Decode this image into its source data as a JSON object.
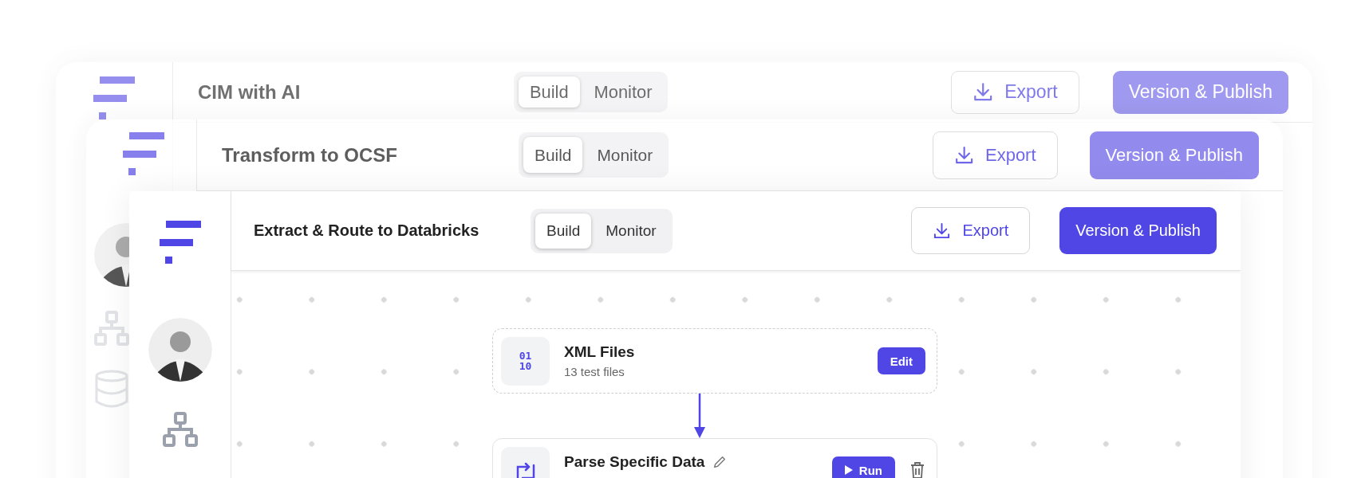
{
  "windows": [
    {
      "title": "CIM with AI",
      "tabs": [
        {
          "label": "Build",
          "selected": true
        },
        {
          "label": "Monitor",
          "selected": false
        }
      ],
      "export_label": "Export",
      "publish_label": "Version & Publish"
    },
    {
      "title": "Transform to OCSF",
      "tabs": [
        {
          "label": "Build",
          "selected": true
        },
        {
          "label": "Monitor",
          "selected": false
        }
      ],
      "export_label": "Export",
      "publish_label": "Version & Publish"
    },
    {
      "title": "Extract & Route to Databricks",
      "tabs": [
        {
          "label": "Build",
          "selected": true
        },
        {
          "label": "Monitor",
          "selected": false
        }
      ],
      "export_label": "Export",
      "publish_label": "Version & Publish",
      "nodes": [
        {
          "kind": "source",
          "icon_lines": [
            "01",
            "10"
          ],
          "title": "XML Files",
          "subtitle": "13 test files",
          "action": "Edit"
        },
        {
          "kind": "step",
          "title": "Parse Specific Data",
          "action": "Run"
        }
      ]
    }
  ]
}
